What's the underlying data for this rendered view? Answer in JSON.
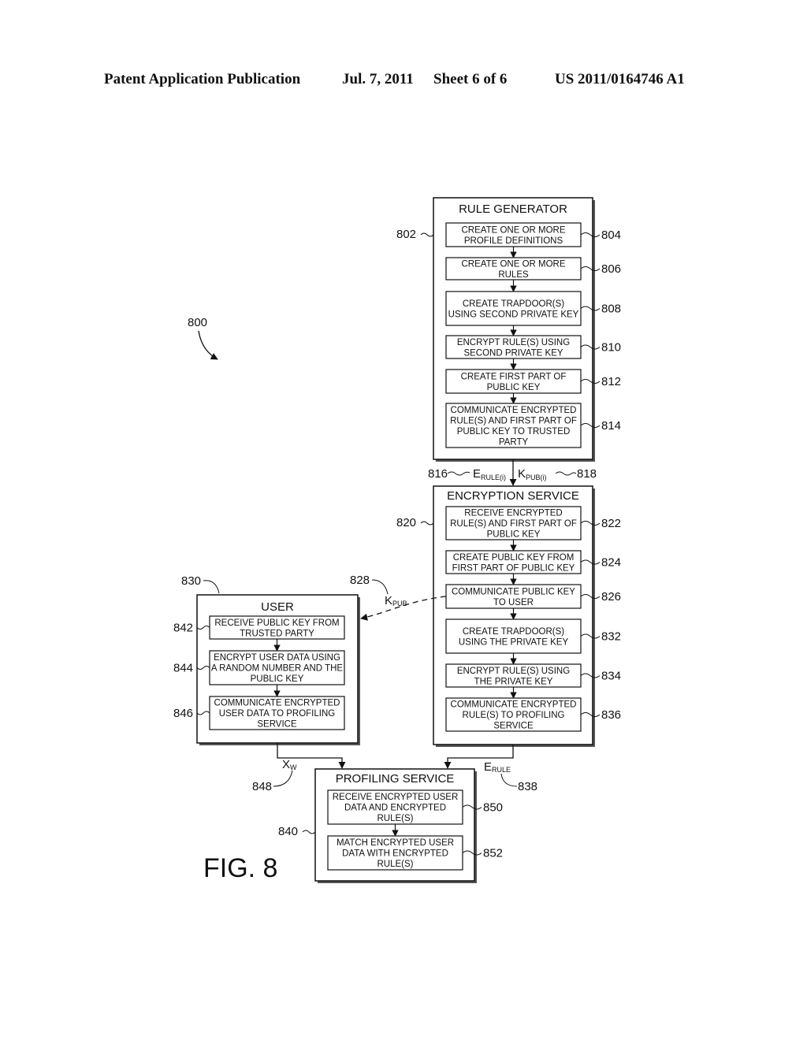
{
  "header": {
    "publication_type": "Patent Application Publication",
    "date": "Jul. 7, 2011",
    "sheet": "Sheet 6 of 6",
    "publication_number": "US 2011/0164746 A1"
  },
  "figure": {
    "label": "FIG. 8",
    "ref": "800"
  },
  "rule_generator": {
    "title": "RULE GENERATOR",
    "ref": "802",
    "steps": [
      {
        "ref": "804",
        "lines": [
          "CREATE ONE OR MORE",
          "PROFILE DEFINITIONS"
        ]
      },
      {
        "ref": "806",
        "lines": [
          "CREATE ONE OR MORE",
          "RULES"
        ]
      },
      {
        "ref": "808",
        "lines": [
          "CREATE TRAPDOOR(S)",
          "USING SECOND PRIVATE KEY"
        ]
      },
      {
        "ref": "810",
        "lines": [
          "ENCRYPT RULE(S) USING",
          "SECOND PRIVATE KEY"
        ]
      },
      {
        "ref": "812",
        "lines": [
          "CREATE FIRST PART OF",
          "PUBLIC KEY"
        ]
      },
      {
        "ref": "814",
        "lines": [
          "COMMUNICATE ENCRYPTED",
          "RULE(S) AND FIRST PART OF",
          "PUBLIC KEY TO TRUSTED",
          "PARTY"
        ]
      }
    ]
  },
  "transfer_labels": {
    "e_rule_i": {
      "main": "E",
      "sub": "RULE(i)",
      "ref": "816"
    },
    "k_pub_i": {
      "main": "K",
      "sub": "PUB(i)",
      "ref": "818"
    },
    "k_pub": {
      "main": "K",
      "sub": "PUB",
      "ref": "828"
    },
    "x_w": {
      "main": "X",
      "sub": "W",
      "ref": "848"
    },
    "e_rule": {
      "main": "E",
      "sub": "RULE",
      "ref": "838"
    }
  },
  "encryption_service": {
    "title": "ENCRYPTION SERVICE",
    "ref": "820",
    "steps": [
      {
        "ref": "822",
        "lines": [
          "RECEIVE ENCRYPTED",
          "RULE(S) AND FIRST PART OF",
          "PUBLIC KEY"
        ]
      },
      {
        "ref": "824",
        "lines": [
          "CREATE PUBLIC KEY FROM",
          "FIRST PART OF PUBLIC KEY"
        ]
      },
      {
        "ref": "826",
        "lines": [
          "COMMUNICATE PUBLIC KEY",
          "TO USER"
        ]
      },
      {
        "ref": "832",
        "lines": [
          "CREATE TRAPDOOR(S)",
          "USING THE PRIVATE KEY"
        ]
      },
      {
        "ref": "834",
        "lines": [
          "ENCRYPT RULE(S) USING",
          "THE PRIVATE KEY"
        ]
      },
      {
        "ref": "836",
        "lines": [
          "COMMUNICATE ENCRYPTED",
          "RULE(S) TO PROFILING",
          "SERVICE"
        ]
      }
    ]
  },
  "user": {
    "title": "USER",
    "ref": "830",
    "steps": [
      {
        "ref": "842",
        "lines": [
          "RECEIVE PUBLIC KEY FROM",
          "TRUSTED PARTY"
        ]
      },
      {
        "ref": "844",
        "lines": [
          "ENCRYPT USER DATA USING",
          "A RANDOM NUMBER AND THE",
          "PUBLIC KEY"
        ]
      },
      {
        "ref": "846",
        "lines": [
          "COMMUNICATE ENCRYPTED",
          "USER DATA TO PROFILING",
          "SERVICE"
        ]
      }
    ]
  },
  "profiling_service": {
    "title": "PROFILING SERVICE",
    "ref": "840",
    "steps": [
      {
        "ref": "850",
        "lines": [
          "RECEIVE ENCRYPTED USER",
          "DATA AND ENCRYPTED",
          "RULE(S)"
        ]
      },
      {
        "ref": "852",
        "lines": [
          "MATCH ENCRYPTED USER",
          "DATA WITH ENCRYPTED",
          "RULE(S)"
        ]
      }
    ]
  }
}
